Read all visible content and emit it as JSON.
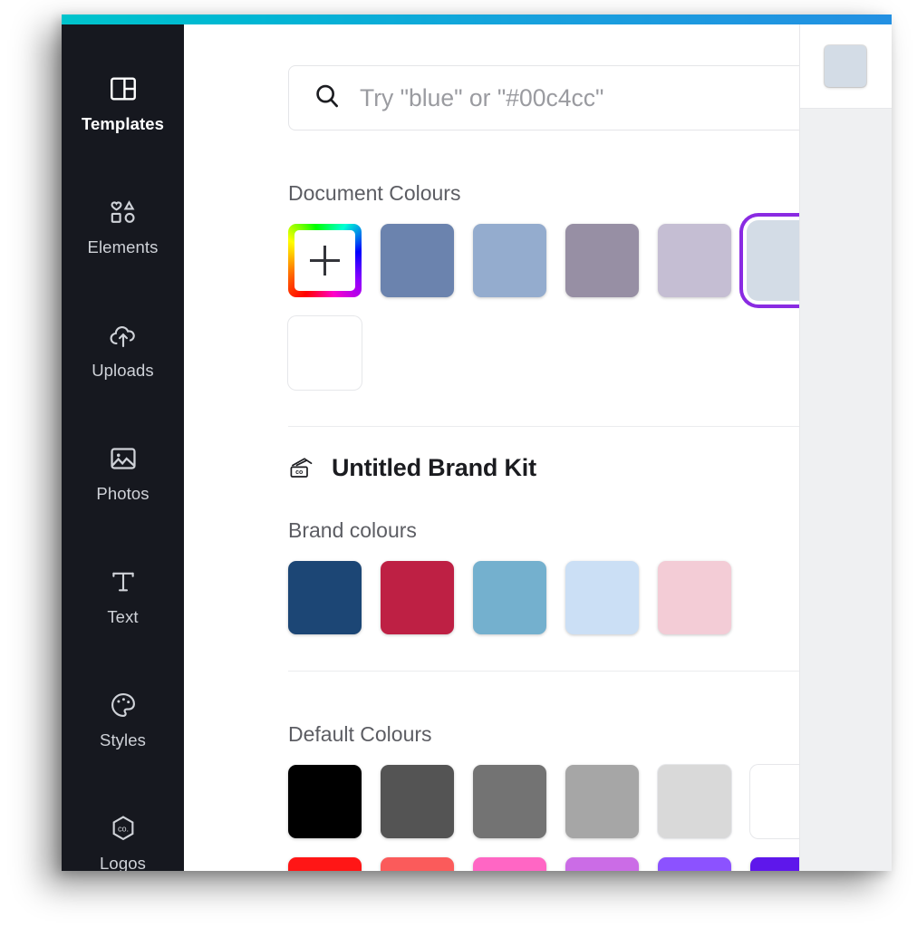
{
  "window": {
    "accent_gradient_from": "#00c4cc",
    "accent_gradient_to": "#2390e2"
  },
  "sidebar": {
    "background": "#16181f",
    "items": [
      {
        "label": "Templates",
        "icon": "templates-icon",
        "active": true
      },
      {
        "label": "Elements",
        "icon": "elements-icon",
        "active": false
      },
      {
        "label": "Uploads",
        "icon": "uploads-icon",
        "active": false
      },
      {
        "label": "Photos",
        "icon": "photos-icon",
        "active": false
      },
      {
        "label": "Text",
        "icon": "text-icon",
        "active": false
      },
      {
        "label": "Styles",
        "icon": "styles-icon",
        "active": false
      },
      {
        "label": "Logos",
        "icon": "logos-icon",
        "active": false
      }
    ]
  },
  "search": {
    "placeholder": "Try \"blue\" or \"#00c4cc\"",
    "value": "",
    "icon": "search-icon"
  },
  "document_colours": {
    "title": "Document Colours",
    "add_label": "+",
    "swatches": [
      {
        "hex": "#6b83ae",
        "selected": false
      },
      {
        "hex": "#94acce",
        "selected": false
      },
      {
        "hex": "#978fa4",
        "selected": false
      },
      {
        "hex": "#c5bed3",
        "selected": false
      },
      {
        "hex": "#d3dce6",
        "selected": true
      },
      {
        "hex": "#ffffff",
        "selected": false
      }
    ],
    "selection_ring": "#8a2be2"
  },
  "brand_kit": {
    "title": "Untitled Brand Kit",
    "icon": "brand-kit-icon",
    "colours_title": "Brand colours",
    "crown_icon": "crown-icon",
    "swatches": [
      {
        "hex": "#1c4675"
      },
      {
        "hex": "#be2044"
      },
      {
        "hex": "#74b0ce"
      },
      {
        "hex": "#cbdff5"
      },
      {
        "hex": "#f3ccd6"
      }
    ]
  },
  "default_colours": {
    "title": "Default Colours",
    "swatches": [
      {
        "hex": "#000000"
      },
      {
        "hex": "#545454"
      },
      {
        "hex": "#737373"
      },
      {
        "hex": "#a6a6a6"
      },
      {
        "hex": "#d9d9d9"
      },
      {
        "hex": "#ffffff"
      },
      {
        "hex": "#ff1616"
      },
      {
        "hex": "#fb5b5b"
      },
      {
        "hex": "#ff66c4"
      },
      {
        "hex": "#cb6ce6"
      },
      {
        "hex": "#8c52ff"
      },
      {
        "hex": "#5e17eb"
      }
    ]
  },
  "editor": {
    "color_tool_hex": "#d3dce6",
    "color_tool_name": "colour-picker-button"
  }
}
